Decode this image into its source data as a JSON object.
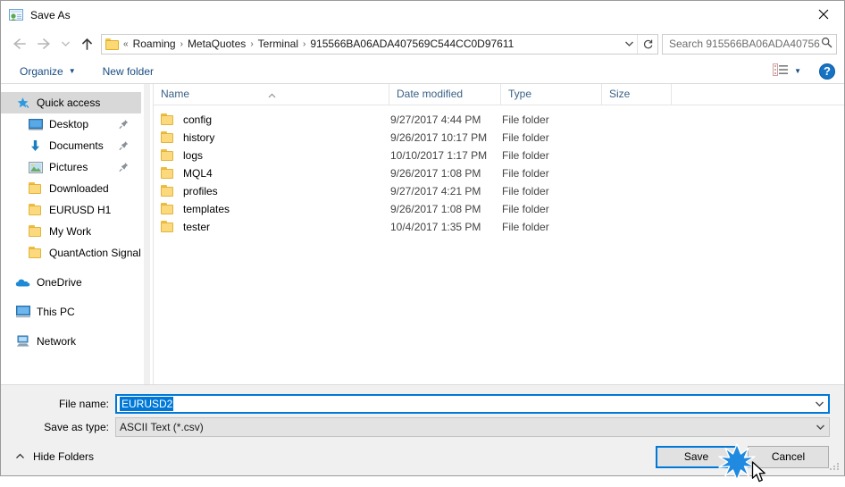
{
  "window": {
    "title": "Save As",
    "icon": "save-as-icon",
    "close_label": "✕"
  },
  "nav": {
    "back_icon": "arrow-left-icon",
    "forward_icon": "arrow-right-icon",
    "recent_icon": "chevron-down-icon",
    "up_icon": "arrow-up-icon",
    "refresh_icon": "refresh-icon",
    "path_dropdown_icon": "chevron-down-icon",
    "breadcrumb_prefix": "«",
    "breadcrumbs": [
      "Roaming",
      "MetaQuotes",
      "Terminal",
      "915566BA06ADA407569C544CC0D97611"
    ],
    "separator": "›"
  },
  "search": {
    "placeholder": "Search 915566BA06ADA40756...",
    "icon": "search-icon"
  },
  "toolbar": {
    "organize_label": "Organize",
    "organize_caret": "▼",
    "new_folder_label": "New folder",
    "view_icon": "view-layout-icon",
    "view_caret": "▼",
    "help_label": "?"
  },
  "sidebar": {
    "items": [
      {
        "label": "Quick access",
        "icon": "star-pin-icon",
        "selected": true,
        "indent": false,
        "pinned": false
      },
      {
        "label": "Desktop",
        "icon": "desktop-icon",
        "selected": false,
        "indent": true,
        "pinned": true
      },
      {
        "label": "Documents",
        "icon": "documents-download-icon",
        "selected": false,
        "indent": true,
        "pinned": true
      },
      {
        "label": "Pictures",
        "icon": "pictures-icon",
        "selected": false,
        "indent": true,
        "pinned": true
      },
      {
        "label": "Downloaded",
        "icon": "folder-icon",
        "selected": false,
        "indent": true,
        "pinned": false
      },
      {
        "label": "EURUSD H1",
        "icon": "folder-icon",
        "selected": false,
        "indent": true,
        "pinned": false
      },
      {
        "label": "My Work",
        "icon": "folder-icon",
        "selected": false,
        "indent": true,
        "pinned": false
      },
      {
        "label": "QuantAction Signal",
        "icon": "folder-icon",
        "selected": false,
        "indent": true,
        "pinned": false
      },
      {
        "label": "OneDrive",
        "icon": "onedrive-cloud-icon",
        "selected": false,
        "indent": false,
        "pinned": false,
        "gap_before": true
      },
      {
        "label": "This PC",
        "icon": "this-pc-icon",
        "selected": false,
        "indent": false,
        "pinned": false,
        "gap_before": true
      },
      {
        "label": "Network",
        "icon": "network-icon",
        "selected": false,
        "indent": false,
        "pinned": false,
        "gap_before": true
      }
    ]
  },
  "filelist": {
    "columns": [
      {
        "label": "Name",
        "sorted": "asc"
      },
      {
        "label": "Date modified",
        "sorted": ""
      },
      {
        "label": "Type",
        "sorted": ""
      },
      {
        "label": "Size",
        "sorted": ""
      }
    ],
    "rows": [
      {
        "name": "config",
        "date": "9/27/2017 4:44 PM",
        "type": "File folder",
        "size": ""
      },
      {
        "name": "history",
        "date": "9/26/2017 10:17 PM",
        "type": "File folder",
        "size": ""
      },
      {
        "name": "logs",
        "date": "10/10/2017 1:17 PM",
        "type": "File folder",
        "size": ""
      },
      {
        "name": "MQL4",
        "date": "9/26/2017 1:08 PM",
        "type": "File folder",
        "size": ""
      },
      {
        "name": "profiles",
        "date": "9/27/2017 4:21 PM",
        "type": "File folder",
        "size": ""
      },
      {
        "name": "templates",
        "date": "9/26/2017 1:08 PM",
        "type": "File folder",
        "size": ""
      },
      {
        "name": "tester",
        "date": "10/4/2017 1:35 PM",
        "type": "File folder",
        "size": ""
      }
    ]
  },
  "form": {
    "filename_label": "File name:",
    "filename_value": "EURUSD2",
    "filetype_label": "Save as type:",
    "filetype_value": "ASCII Text (*.csv)",
    "dropdown_icon": "chevron-down-icon"
  },
  "footer": {
    "hide_folders_label": "Hide Folders",
    "hide_folders_icon": "chevron-up-icon",
    "save_label": "Save",
    "cancel_label": "Cancel",
    "resize_grip_icon": "resize-grip-icon",
    "click_indicator_icon": "click-burst-icon",
    "cursor_icon": "mouse-pointer-icon"
  },
  "colors": {
    "accent": "#0078d7",
    "link": "#1a4d82",
    "header_text": "#3a6186",
    "folder": "#fcd97c",
    "dialog_bg": "#f0f0f0",
    "selection": "#d8d8d8"
  }
}
